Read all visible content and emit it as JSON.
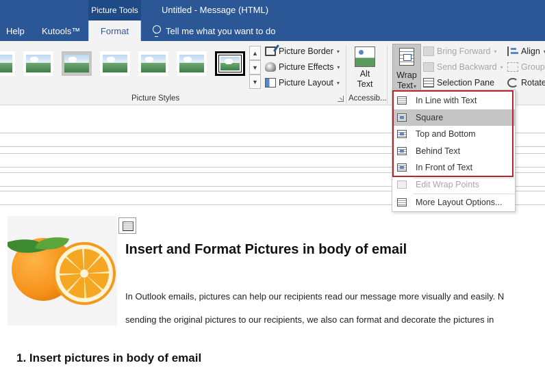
{
  "titlebar": {
    "context_tab": "Picture Tools",
    "window_title": "Untitled  -  Message (HTML)"
  },
  "tabs": [
    {
      "label": "Help"
    },
    {
      "label": "Kutools™"
    },
    {
      "label": "Format"
    }
  ],
  "tell_me": "Tell me what you want to do",
  "ribbon": {
    "picture_border": "Picture Border",
    "picture_effects": "Picture Effects",
    "picture_layout": "Picture Layout",
    "picture_styles_label": "Picture Styles",
    "alt_text_line1": "Alt",
    "alt_text_line2": "Text",
    "accessibility_label": "Accessib...",
    "wrap_text_line1": "Wrap",
    "wrap_text_line2": "Text",
    "bring_forward": "Bring Forward",
    "send_backward": "Send Backward",
    "selection_pane": "Selection Pane",
    "align": "Align",
    "group": "Group",
    "rotate": "Rotate"
  },
  "wrap_menu": {
    "items": [
      {
        "label": "In Line with Text"
      },
      {
        "label": "Square"
      },
      {
        "label": "Top and Bottom"
      },
      {
        "label": "Behind Text"
      },
      {
        "label": "In Front of Text"
      },
      {
        "label": "Edit Wrap Points"
      },
      {
        "label": "More Layout Options..."
      }
    ]
  },
  "document": {
    "heading": "Insert and Format Pictures in body of email",
    "para1": "In Outlook emails, pictures can help our recipients read our message more visually and easily. N",
    "para2": "sending the original pictures to our recipients, we also can format and decorate the pictures in",
    "section1": "1.  Insert pictures in body of email"
  }
}
